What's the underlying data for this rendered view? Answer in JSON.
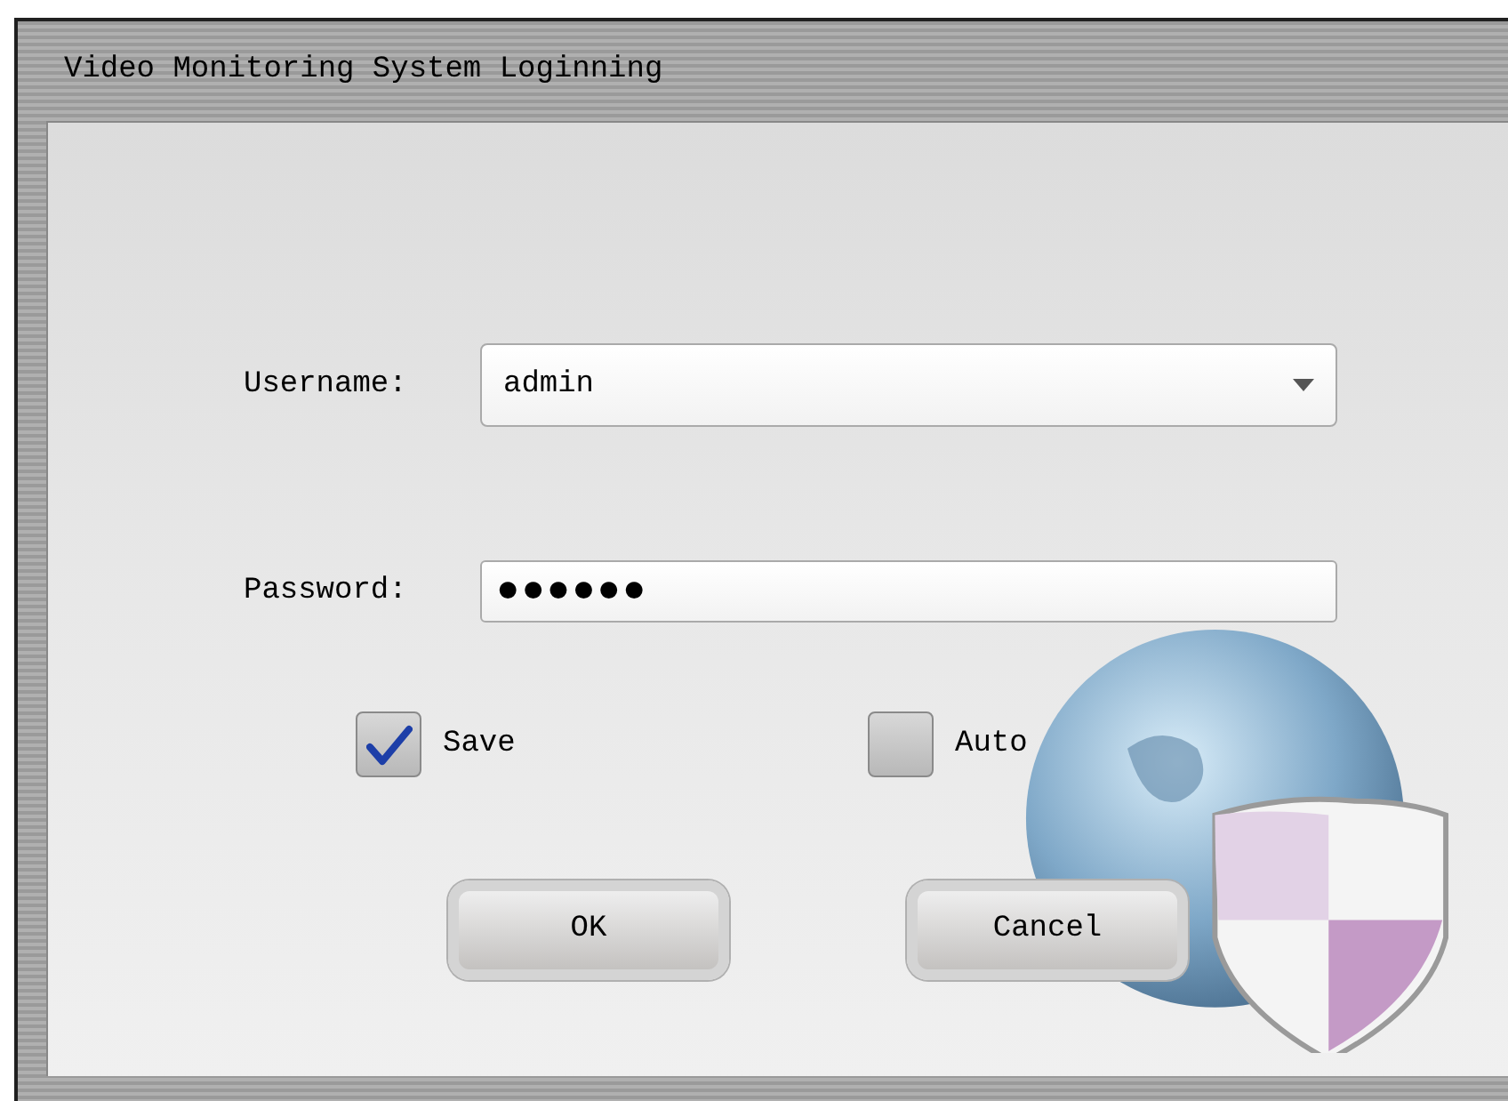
{
  "window": {
    "title": "Video Monitoring System Loginning"
  },
  "username": {
    "label": "Username:",
    "value": "admin"
  },
  "password": {
    "label": "Password:",
    "value": "●●●●●●"
  },
  "options": [
    {
      "label": "Save",
      "checked": true
    },
    {
      "label": "Auto",
      "checked": false
    }
  ],
  "buttons": [
    "OK",
    "Cancel"
  ]
}
